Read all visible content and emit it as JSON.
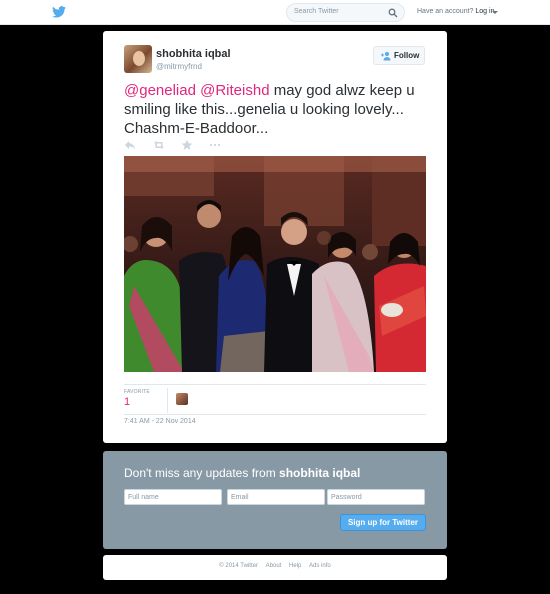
{
  "header": {
    "search_placeholder": "Search Twitter",
    "account_prompt": "Have an account?",
    "login_label": "Log in"
  },
  "tweet": {
    "author_name": "shobhita iqbal",
    "author_handle": "@mitrmyfrnd",
    "follow_label": "Follow",
    "mention_1": "@geneliad",
    "mention_2": "@Riteishd",
    "text_body": " may god alwz keep u smiling like this...genelia u looking lovely... Chashm-E-Baddoor...",
    "favorite_label": "FAVORITE",
    "favorite_count": "1",
    "timestamp": "7:41 AM - 22 Nov 2014"
  },
  "signup": {
    "title_prefix": "Don't miss any updates from ",
    "title_name": "shobhita iqbal",
    "fullname_placeholder": "Full name",
    "email_placeholder": "Email",
    "password_placeholder": "Password",
    "button_label": "Sign up for Twitter"
  },
  "footer": {
    "copyright": "© 2014 Twitter",
    "about": "About",
    "help": "Help",
    "ads_info": "Ads info"
  },
  "colors": {
    "mention": "#e0277c",
    "brand_blue": "#55acee",
    "signup_panel": "#8899a6"
  }
}
